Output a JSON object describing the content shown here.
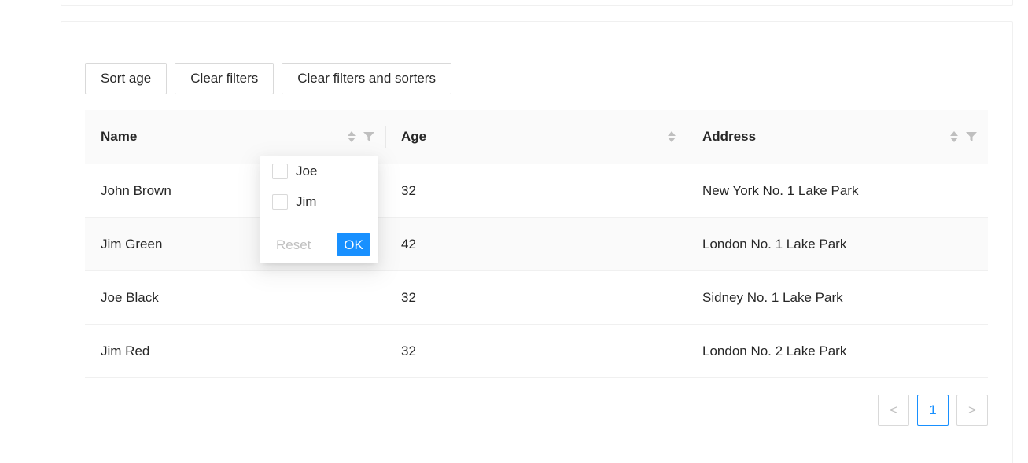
{
  "toolbar": {
    "sort_age": "Sort age",
    "clear_filters": "Clear filters",
    "clear_filters_sorters": "Clear filters and sorters"
  },
  "table": {
    "columns": [
      "Name",
      "Age",
      "Address"
    ],
    "rows": [
      {
        "name": "John Brown",
        "age": "32",
        "address": "New York No. 1 Lake Park"
      },
      {
        "name": "Jim Green",
        "age": "42",
        "address": "London No. 1 Lake Park"
      },
      {
        "name": "Joe Black",
        "age": "32",
        "address": "Sidney No. 1 Lake Park"
      },
      {
        "name": "Jim Red",
        "age": "32",
        "address": "London No. 2 Lake Park"
      }
    ]
  },
  "filter_dropdown": {
    "options": [
      "Joe",
      "Jim"
    ],
    "reset": "Reset",
    "ok": "OK"
  },
  "pagination": {
    "prev": "<",
    "current": "1",
    "next": ">"
  },
  "colors": {
    "primary": "#1890ff",
    "border": "#d9d9d9",
    "header_bg": "#fafafa"
  }
}
